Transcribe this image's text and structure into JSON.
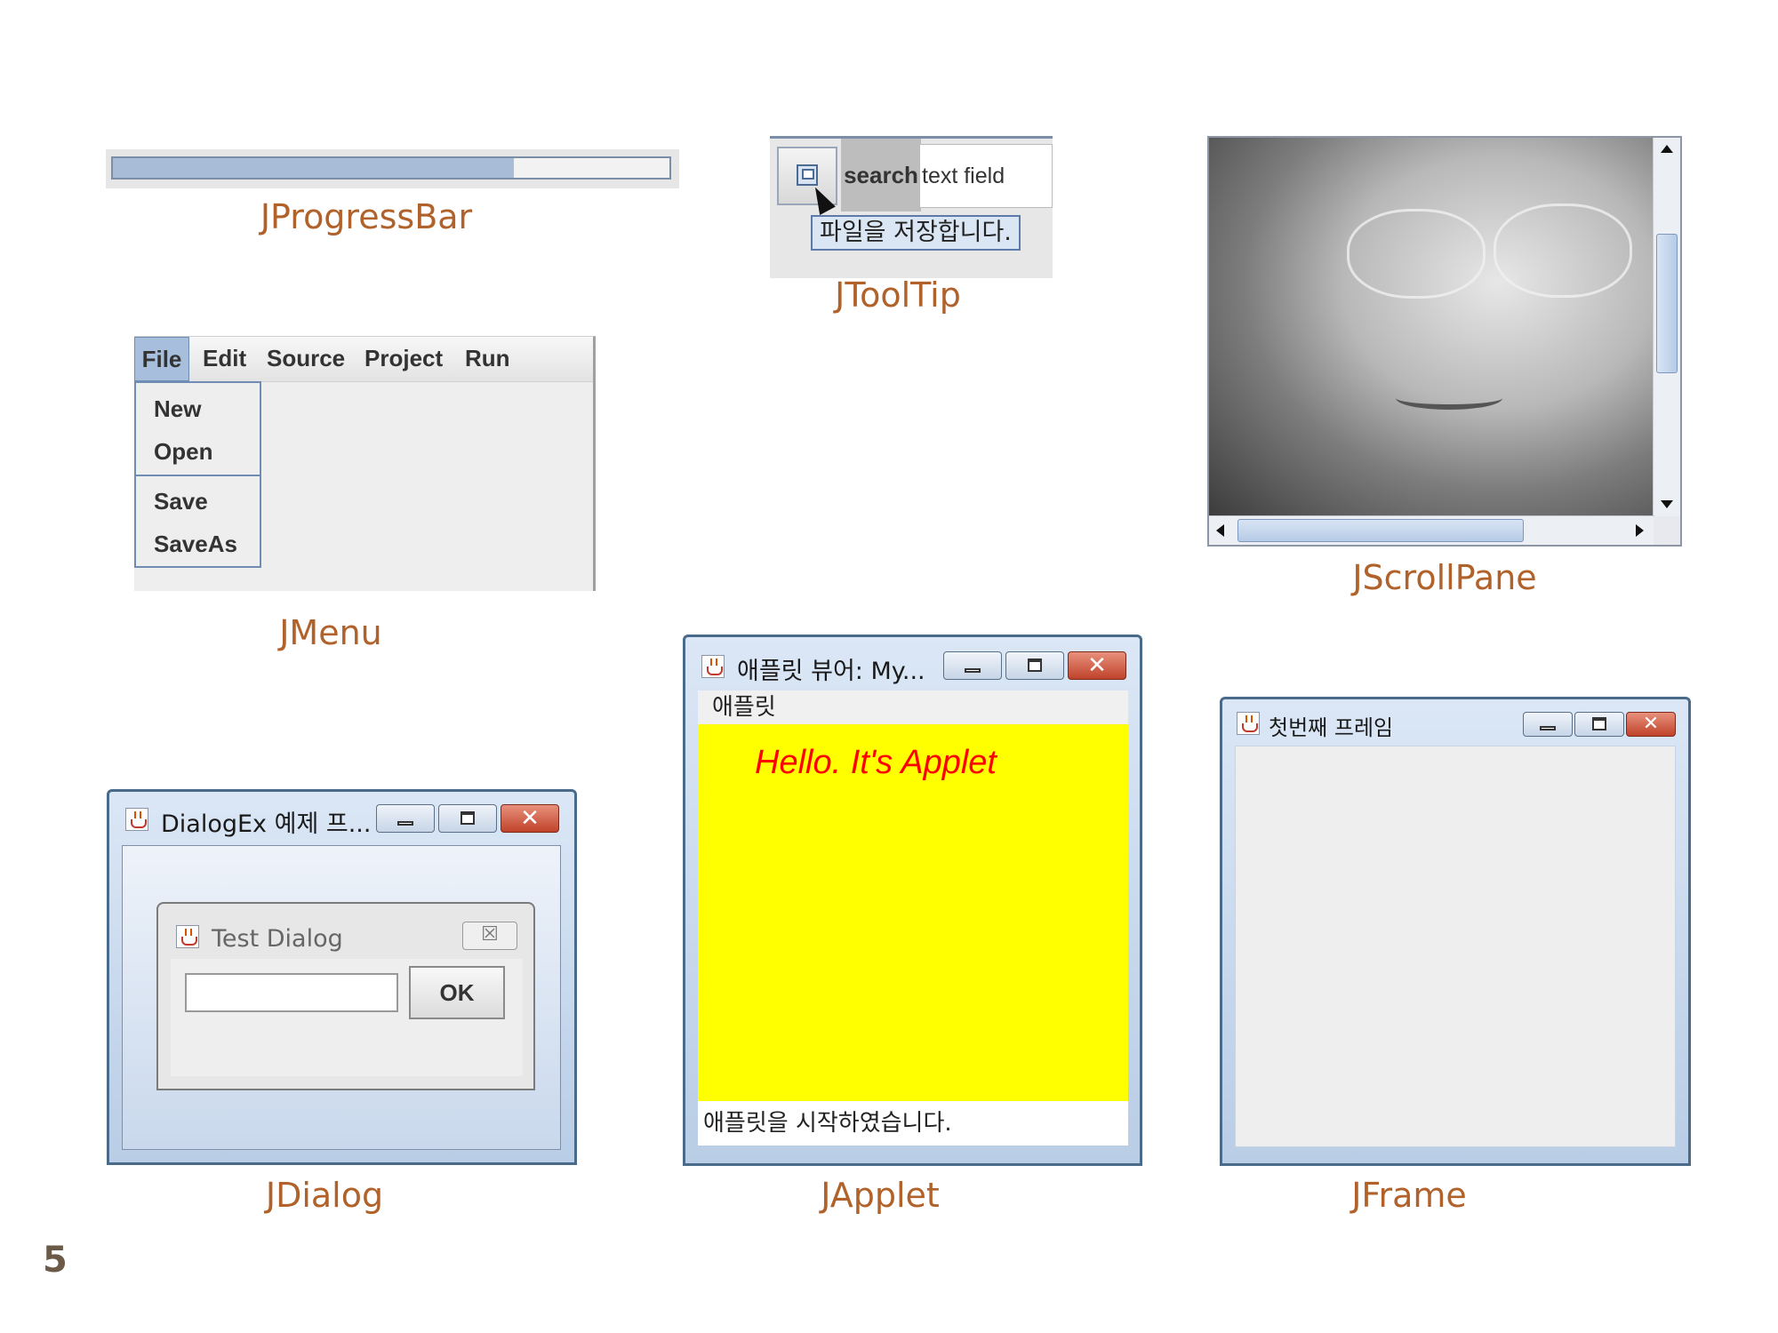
{
  "page_number": "5",
  "progress_bar": {
    "caption": "JProgressBar",
    "fraction": 0.72
  },
  "tooltip": {
    "caption": "JToolTip",
    "button_icon": "save-icon",
    "label": "search",
    "field_text": "text field",
    "tooltip_text": "파일을 저장합니다."
  },
  "scroll_pane": {
    "caption": "JScrollPane",
    "content": "photo-of-face"
  },
  "menu": {
    "caption": "JMenu",
    "menubar": [
      "File",
      "Edit",
      "Source",
      "Project",
      "Run"
    ],
    "selected": "File",
    "items": [
      "New",
      "Open",
      "Save",
      "SaveAs"
    ]
  },
  "dialog": {
    "caption": "JDialog",
    "window_title": "DialogEx 예제 프...",
    "inner_title": "Test Dialog",
    "inner_close": "☒",
    "ok_label": "OK",
    "close_glyph": "✕"
  },
  "applet": {
    "caption": "JApplet",
    "window_title": "애플릿 뷰어: My...",
    "menu_label": "애플릿",
    "hello_text": "Hello. It's Applet",
    "status_text": "애플릿을 시작하였습니다.",
    "canvas_color": "#ffff00",
    "text_color": "#ff0000",
    "close_glyph": "✕"
  },
  "frame": {
    "caption": "JFrame",
    "window_title": "첫번째 프레임",
    "close_glyph": "✕"
  },
  "colors": {
    "caption": "#b0622a",
    "window_border": "#4a6a8a",
    "selection": "#a7bfdc"
  }
}
